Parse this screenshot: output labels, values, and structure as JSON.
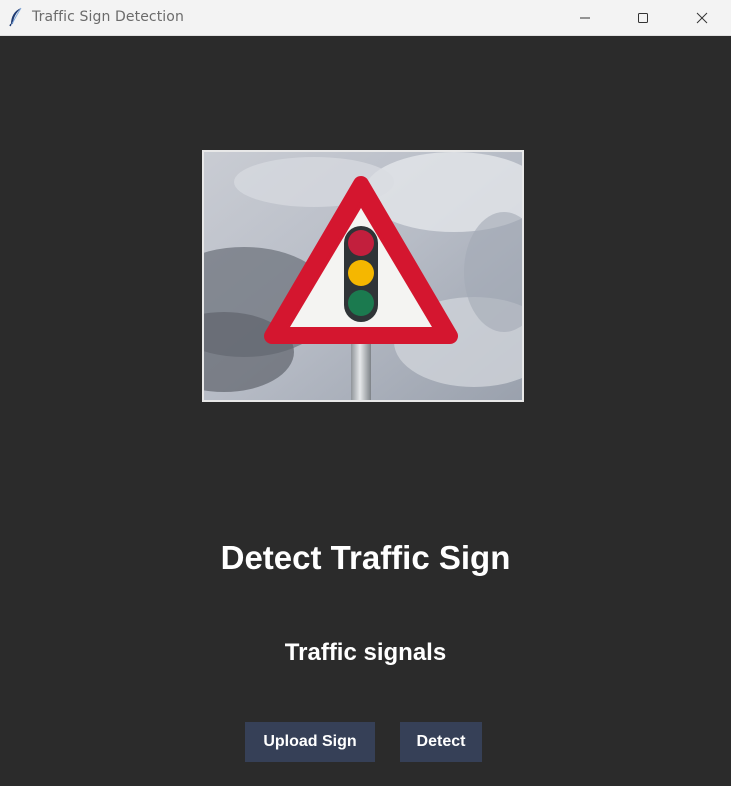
{
  "window": {
    "title": "Traffic Sign Detection"
  },
  "titlebar_icons": {
    "app": "feather-icon",
    "minimize": "minimize-icon",
    "maximize": "maximize-icon",
    "close": "close-icon"
  },
  "main": {
    "heading": "Detect Traffic Sign",
    "result": "Traffic signals",
    "upload_label": "Upload Sign",
    "detect_label": "Detect"
  },
  "image": {
    "description_icon": "traffic-signals-warning-sign"
  },
  "colors": {
    "background": "#2b2b2b",
    "button": "#364057",
    "text": "#ffffff",
    "titlebar": "#f3f3f3"
  }
}
